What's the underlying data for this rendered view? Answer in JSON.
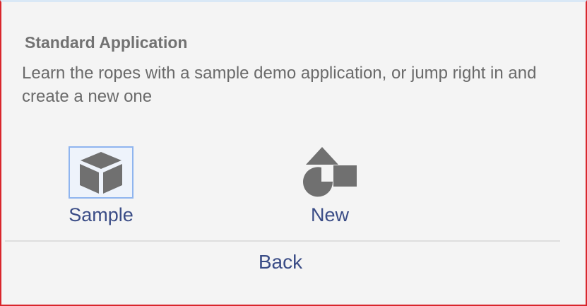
{
  "section": {
    "title": "Standard Application",
    "description": "Learn the ropes with a sample demo application, or jump right in and create a new one"
  },
  "options": [
    {
      "label": "Sample",
      "icon": "cube-icon",
      "focused": true
    },
    {
      "label": "New",
      "icon": "shapes-icon",
      "focused": false
    }
  ],
  "footer": {
    "back_label": "Back"
  },
  "colors": {
    "frame_border": "#d9262c",
    "link_text": "#3a4c86",
    "icon_gray": "#707070",
    "focus_ring": "#8fb5ef"
  }
}
